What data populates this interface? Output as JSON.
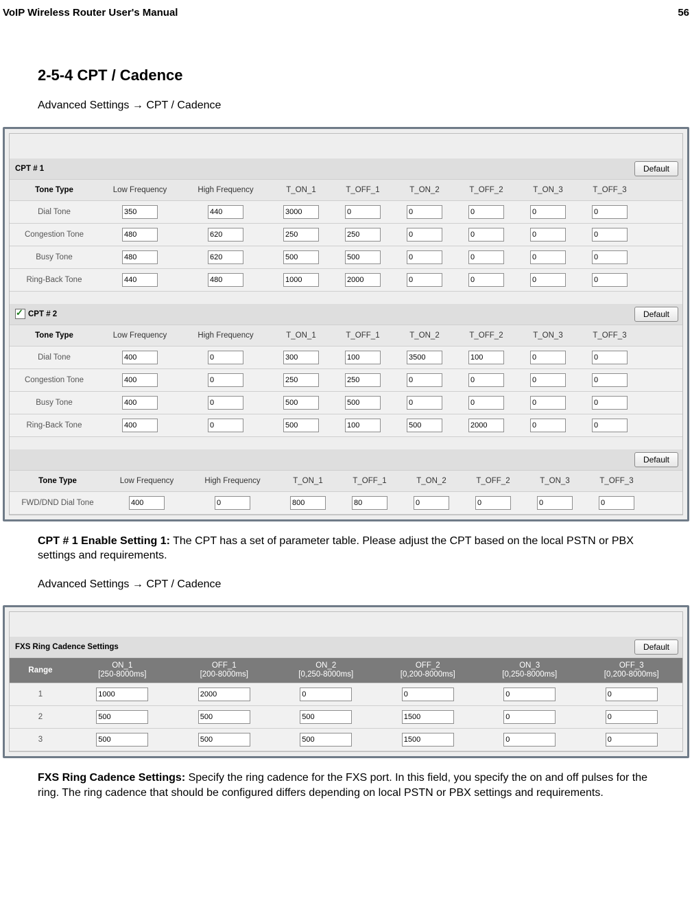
{
  "page": {
    "running_title": "VoIP Wireless Router User's Manual",
    "page_number": "56",
    "section_heading": "2-5-4 CPT / Cadence",
    "breadcrumb": "Advanced Settings  →   CPT / Cadence",
    "para_cpt1_bold": "CPT # 1 Enable Setting 1:",
    "para_cpt1_rest": " The CPT has a set of parameter table. Please adjust the CPT based on the local PSTN or PBX settings and requirements.",
    "breadcrumb2": "Advanced Settings  →   CPT / Cadence",
    "para_fxs_bold": "FXS Ring Cadence Settings:",
    "para_fxs_rest": " Specify the ring cadence for the FXS port. In this field, you specify the on and off pulses for the ring. The ring cadence that should be configured differs depending on local PSTN or PBX settings and requirements."
  },
  "buttons": {
    "default": "Default"
  },
  "cpt": {
    "headers": {
      "tone_type": "Tone Type",
      "low_freq": "Low Frequency",
      "high_freq": "High Frequency",
      "t_on_1": "T_ON_1",
      "t_off_1": "T_OFF_1",
      "t_on_2": "T_ON_2",
      "t_off_2": "T_OFF_2",
      "t_on_3": "T_ON_3",
      "t_off_3": "T_OFF_3"
    },
    "section1_title": "CPT # 1",
    "section2_title": "CPT # 2",
    "section2_checked": true,
    "cpt1": [
      {
        "tone": "Dial Tone",
        "lf": "350",
        "hf": "440",
        "t1": "3000",
        "t2": "0",
        "t3": "0",
        "t4": "0",
        "t5": "0",
        "t6": "0"
      },
      {
        "tone": "Congestion Tone",
        "lf": "480",
        "hf": "620",
        "t1": "250",
        "t2": "250",
        "t3": "0",
        "t4": "0",
        "t5": "0",
        "t6": "0"
      },
      {
        "tone": "Busy Tone",
        "lf": "480",
        "hf": "620",
        "t1": "500",
        "t2": "500",
        "t3": "0",
        "t4": "0",
        "t5": "0",
        "t6": "0"
      },
      {
        "tone": "Ring-Back Tone",
        "lf": "440",
        "hf": "480",
        "t1": "1000",
        "t2": "2000",
        "t3": "0",
        "t4": "0",
        "t5": "0",
        "t6": "0"
      }
    ],
    "cpt2": [
      {
        "tone": "Dial Tone",
        "lf": "400",
        "hf": "0",
        "t1": "300",
        "t2": "100",
        "t3": "3500",
        "t4": "100",
        "t5": "0",
        "t6": "0"
      },
      {
        "tone": "Congestion Tone",
        "lf": "400",
        "hf": "0",
        "t1": "250",
        "t2": "250",
        "t3": "0",
        "t4": "0",
        "t5": "0",
        "t6": "0"
      },
      {
        "tone": "Busy Tone",
        "lf": "400",
        "hf": "0",
        "t1": "500",
        "t2": "500",
        "t3": "0",
        "t4": "0",
        "t5": "0",
        "t6": "0"
      },
      {
        "tone": "Ring-Back Tone",
        "lf": "400",
        "hf": "0",
        "t1": "500",
        "t2": "100",
        "t3": "500",
        "t4": "2000",
        "t5": "0",
        "t6": "0"
      }
    ],
    "fwd_row": {
      "tone": "FWD/DND Dial Tone",
      "lf": "400",
      "hf": "0",
      "t1": "800",
      "t2": "80",
      "t3": "0",
      "t4": "0",
      "t5": "0",
      "t6": "0"
    }
  },
  "fxs": {
    "section_title": "FXS Ring Cadence Settings",
    "headers": {
      "range": "Range",
      "on1_a": "ON_1",
      "on1_b": "[250-8000ms]",
      "off1_a": "OFF_1",
      "off1_b": "[200-8000ms]",
      "on2_a": "ON_2",
      "on2_b": "[0,250-8000ms]",
      "off2_a": "OFF_2",
      "off2_b": "[0,200-8000ms]",
      "on3_a": "ON_3",
      "on3_b": "[0,250-8000ms]",
      "off3_a": "OFF_3",
      "off3_b": "[0,200-8000ms]"
    },
    "rows": [
      {
        "range": "1",
        "on1": "1000",
        "off1": "2000",
        "on2": "0",
        "off2": "0",
        "on3": "0",
        "off3": "0"
      },
      {
        "range": "2",
        "on1": "500",
        "off1": "500",
        "on2": "500",
        "off2": "1500",
        "on3": "0",
        "off3": "0"
      },
      {
        "range": "3",
        "on1": "500",
        "off1": "500",
        "on2": "500",
        "off2": "1500",
        "on3": "0",
        "off3": "0"
      }
    ]
  }
}
